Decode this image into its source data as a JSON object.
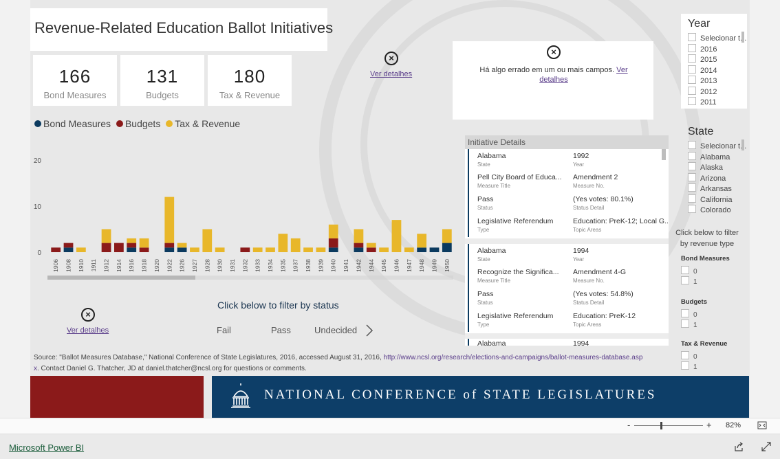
{
  "report": {
    "title": "Revenue-Related Education Ballot Initiatives",
    "kpis": [
      {
        "value": "166",
        "label": "Bond Measures"
      },
      {
        "value": "131",
        "label": "Budgets"
      },
      {
        "value": "180",
        "label": "Tax & Revenue"
      }
    ],
    "error1": {
      "link": "Ver detalhes"
    },
    "error2": {
      "message": "Há algo errado em um ou mais campos.",
      "link": "Ver detalhes"
    },
    "error3": {
      "link": "Ver detalhes"
    },
    "legend": [
      {
        "label": "Bond Measures",
        "color": "#0b3a5f"
      },
      {
        "label": "Budgets",
        "color": "#8b1a1a"
      },
      {
        "label": "Tax & Revenue",
        "color": "#e8b72a"
      }
    ],
    "status_filter": {
      "prompt": "Click below to filter by status",
      "options": [
        "Fail",
        "Pass",
        "Undecided"
      ],
      "next_icon": "chevron-right-icon"
    },
    "source_text": "Source: \"Ballot Measures Database,\" National Conference of State Legislatures, 2016, accessed August 31, 2016,",
    "source_url": "http://www.ncsl.org/research/elections-and-campaigns/ballot-measures-database.aspx",
    "source_tail": ". Contact Daniel G. Thatcher, JD at daniel.thatcher@ncsl.org for questions or comments.",
    "banner": "NATIONAL CONFERENCE of STATE LEGISLATURES"
  },
  "year_slicer": {
    "title": "Year",
    "items": [
      "Selecionar t...",
      "2016",
      "2015",
      "2014",
      "2013",
      "2012",
      "2011"
    ]
  },
  "state_slicer": {
    "title": "State",
    "items": [
      "Selecionar t...",
      "Alabama",
      "Alaska",
      "Arizona",
      "Arkansas",
      "California",
      "Colorado"
    ]
  },
  "revenue_filter": {
    "prompt": "Click below to filter by revenue type",
    "groups": [
      {
        "title": "Bond Measures",
        "options": [
          "0",
          "1"
        ]
      },
      {
        "title": "Budgets",
        "options": [
          "0",
          "1"
        ]
      },
      {
        "title": "Tax & Revenue",
        "options": [
          "0",
          "1"
        ]
      }
    ]
  },
  "details": {
    "header": "Initiative Details",
    "records": [
      {
        "state": "Alabama",
        "year": "1992",
        "measure_title": "Pell City Board of Educa...",
        "measure_no": "Amendment 2",
        "status": "Pass",
        "status_detail": "(Yes votes: 80.1%)",
        "type": "Legislative Referendum",
        "topic": "Education: PreK-12; Local G..."
      },
      {
        "state": "Alabama",
        "year": "1994",
        "measure_title": "Recognize the Significa...",
        "measure_no": "Amendment 4-G",
        "status": "Pass",
        "status_detail": "(Yes votes: 54.8%)",
        "type": "Legislative Referendum",
        "topic": "Education: PreK-12"
      },
      {
        "state": "Alabama",
        "year": "1994"
      }
    ],
    "keys": {
      "state": "State",
      "year": "Year",
      "measure_title": "Measure Title",
      "measure_no": "Measure No.",
      "status": "Status",
      "status_detail": "Status Detail",
      "type": "Type",
      "topic": "Topic Areas"
    }
  },
  "statusbar": {
    "zoom": "82%",
    "minus": "-",
    "plus": "+"
  },
  "footer": {
    "brand": "Microsoft Power BI"
  },
  "chart_data": {
    "type": "bar",
    "stacked": true,
    "categories": [
      "1906",
      "1908",
      "1910",
      "1911",
      "1912",
      "1914",
      "1916",
      "1918",
      "1920",
      "1922",
      "1926",
      "1927",
      "1928",
      "1930",
      "1931",
      "1932",
      "1933",
      "1934",
      "1935",
      "1937",
      "1938",
      "1939",
      "1940",
      "1941",
      "1942",
      "1944",
      "1945",
      "1946",
      "1947",
      "1948",
      "1949",
      "1950"
    ],
    "series": [
      {
        "name": "Bond Measures",
        "color": "#0b3a5f",
        "values": [
          0,
          1,
          0,
          0,
          0,
          0,
          1,
          0,
          0,
          1,
          1,
          0,
          0,
          0,
          0,
          0,
          0,
          0,
          0,
          0,
          0,
          0,
          1,
          0,
          1,
          0,
          0,
          0,
          0,
          1,
          1,
          2
        ]
      },
      {
        "name": "Budgets",
        "color": "#8b1a1a",
        "values": [
          1,
          1,
          0,
          0,
          2,
          2,
          1,
          1,
          0,
          1,
          0,
          0,
          0,
          0,
          0,
          1,
          0,
          0,
          0,
          0,
          0,
          0,
          2,
          0,
          1,
          1,
          0,
          0,
          0,
          0,
          0,
          0
        ]
      },
      {
        "name": "Tax & Revenue",
        "color": "#e8b72a",
        "values": [
          0,
          0,
          1,
          0,
          3,
          0,
          1,
          2,
          0,
          10,
          1,
          1,
          5,
          1,
          0,
          0,
          1,
          1,
          4,
          3,
          1,
          1,
          3,
          0,
          3,
          1,
          1,
          7,
          1,
          3,
          0,
          3
        ]
      }
    ],
    "yticks": [
      0,
      10,
      20
    ],
    "ylim": [
      0,
      22
    ]
  }
}
